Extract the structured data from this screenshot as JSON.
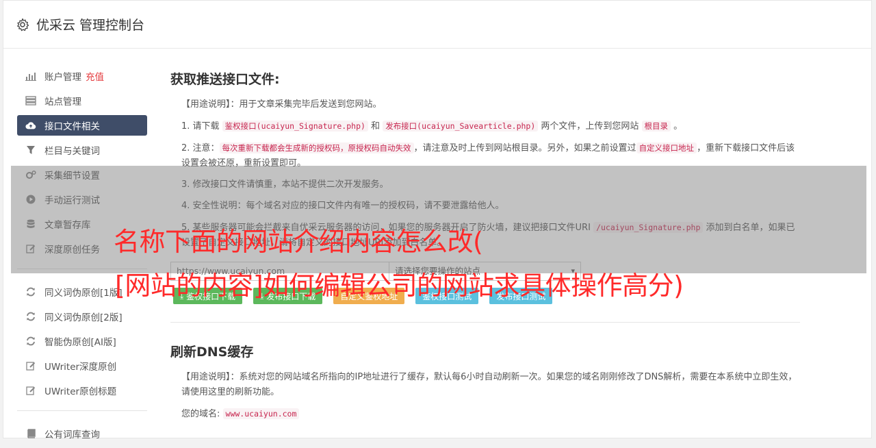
{
  "header": {
    "title": "优采云 管理控制台",
    "icon": "gear-icon"
  },
  "sidebar": {
    "group1": [
      {
        "label": "账户管理",
        "extra": "充值",
        "icon": "bar-chart-icon"
      },
      {
        "label": "站点管理",
        "icon": "server-icon"
      },
      {
        "label": "接口文件相关",
        "icon": "cloud-upload-icon",
        "active": true
      },
      {
        "label": "栏目与关键词",
        "icon": "filter-icon"
      },
      {
        "label": "采集细节设置",
        "icon": "cogs-icon"
      },
      {
        "label": "手动运行测试",
        "icon": "play-icon"
      },
      {
        "label": "文章暂存库",
        "icon": "database-icon"
      },
      {
        "label": "深度原创任务",
        "icon": "edit-icon"
      }
    ],
    "group2": [
      {
        "label": "同义词伪原创[1版]",
        "icon": "refresh-icon"
      },
      {
        "label": "同义词伪原创[2版]",
        "icon": "refresh-icon"
      },
      {
        "label": "智能伪原创[AI版]",
        "icon": "refresh-icon"
      },
      {
        "label": "UWriter深度原创",
        "icon": "edit-icon"
      },
      {
        "label": "UWriter原创标题",
        "icon": "edit-icon"
      }
    ],
    "group3": [
      {
        "label": "公有词库查询",
        "icon": "book-icon"
      }
    ]
  },
  "section1": {
    "title": "获取推送接口文件:",
    "usage": "【用途说明】：用于文章采集完毕后发送到您网站。",
    "p1": {
      "a": "1. 请下载 ",
      "c1": "鉴权接口(ucaiyun_Signature.php)",
      "b": " 和 ",
      "c2": "发布接口(ucaiyun_Savearticle.php)",
      "d": " 两个文件，上传到您网站 ",
      "c3": "根目录",
      "e": " 。"
    },
    "p2": {
      "a": "2. 注意：",
      "c1": "每次重新下载都会生成新的授权码，原授权码自动失效",
      "b": "，请注意及时上传到网站根目录。另外，如果之前设置过",
      "c2": "自定义接口地址",
      "d": "，重新下载接口文件后该设置会被还原，重新设置即可。"
    },
    "p3": "3. 修改接口文件请慎重，本站不提供二次开发服务。",
    "p4": "4. 安全性说明：每个域名对应的接口文件内有唯一的授权码，请不要泄露给他人。",
    "p5": {
      "a": "5. 某些服务器可能会拦截来自优采云服务器的访问，如果您的服务器开启了防火墙，建议把接口文件URI ",
      "c1": "/ucaiyun_Signature.php",
      "b": " 添加到白名单，如果已设置了自定义接口地址，请将自定义的接口地址URI添加到白名单。"
    },
    "site_input": "https://www.ucaiyun.com",
    "site_select": "请选择您要操作的站点",
    "buttons": {
      "sign_download": "鉴权接口下载",
      "publish_download": "发布接口下载",
      "custom_sign": "自定义鉴权地址",
      "sign_test": "鉴权接口测试",
      "publish_test": "发布接口测试"
    }
  },
  "section2": {
    "title": "刷新DNS缓存",
    "usage": "【用途说明】：系统对您的网站域名所指向的IP地址进行了缓存，默认每6小时自动刷新一次。如果您的域名刚刚修改了DNS解析，需要在本系统中立即生效，请使用这里的刷新功能。",
    "domain_label": "您的域名:",
    "domain_value": "www.ucaiyun.com"
  },
  "overlay": {
    "line1": "名称下面的网站介绍内容怎么改(",
    "line2": "[网站的内容]如何编辑公司的网站求具体操作高分)"
  }
}
